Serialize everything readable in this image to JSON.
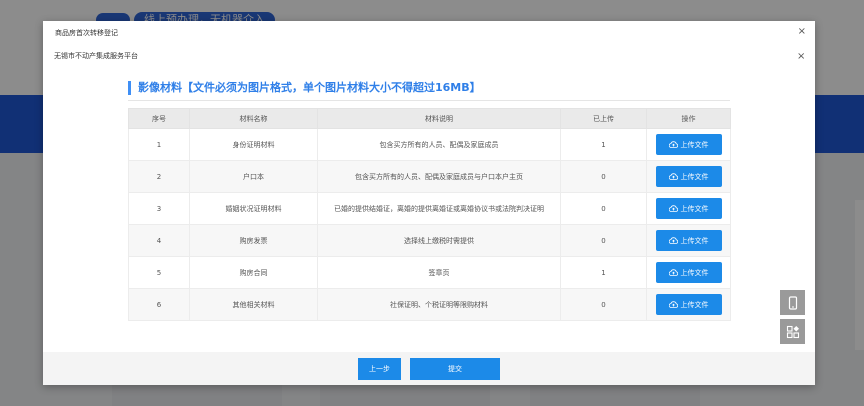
{
  "background": {
    "banner_text": "线上预办理，无机器介入"
  },
  "outer_dialog": {
    "title": "商品房首次转移登记",
    "close_glyph": "×"
  },
  "inner_dialog": {
    "title": "无锡市不动产集成服务平台",
    "close_glyph": "×"
  },
  "section": {
    "title": "影像材料【文件必须为图片格式，单个图片材料大小不得超过16MB】"
  },
  "table": {
    "headers": {
      "index": "序号",
      "name": "材料名称",
      "desc": "材料说明",
      "uploaded": "已上传",
      "action": "操作"
    },
    "upload_label": "上传文件",
    "rows": [
      {
        "index": "1",
        "name": "身份证明材料",
        "desc": "包含买方所有的人员、配偶及家庭成员",
        "uploaded": "1"
      },
      {
        "index": "2",
        "name": "户口本",
        "desc": "包含买方所有的人员、配偶及家庭成员与户口本户主页",
        "uploaded": "0"
      },
      {
        "index": "3",
        "name": "婚姻状况证明材料",
        "desc": "已婚的提供结婚证，离婚的提供离婚证或离婚协议书或法院判决证明",
        "uploaded": "0"
      },
      {
        "index": "4",
        "name": "购房发票",
        "desc": "选择线上缴税时需提供",
        "uploaded": "0"
      },
      {
        "index": "5",
        "name": "购房合同",
        "desc": "签章页",
        "uploaded": "1"
      },
      {
        "index": "6",
        "name": "其他相关材料",
        "desc": "社保证明、个税证明等限购材料",
        "uploaded": "0"
      }
    ]
  },
  "footer": {
    "prev_label": "上一步",
    "submit_label": "提交"
  },
  "icons": {
    "upload": "cloud-upload-icon",
    "mobile": "mobile-phone-icon",
    "apps": "app-grid-icon"
  },
  "colors": {
    "accent": "#1c8ae8",
    "title_blue": "#2f7fe8",
    "band_blue": "#1f58d6"
  }
}
